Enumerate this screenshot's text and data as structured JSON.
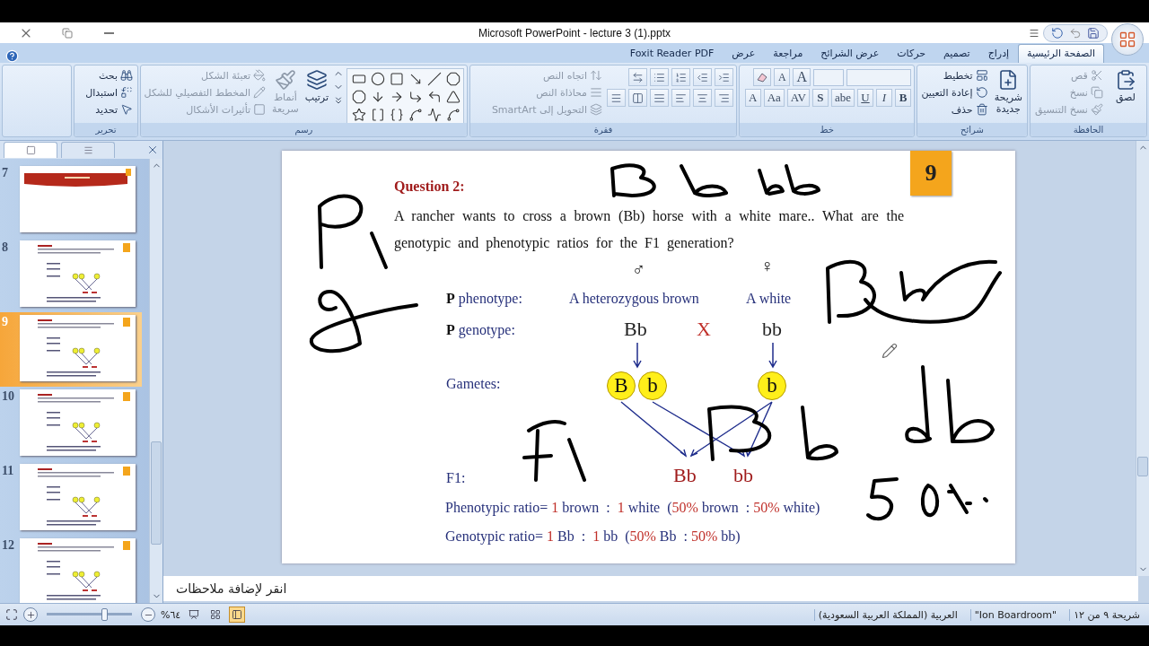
{
  "window": {
    "title": "Microsoft PowerPoint - lecture 3 (1).pptx"
  },
  "ribbon": {
    "tabs": [
      {
        "label": "الصفحة الرئيسية",
        "selected": true
      },
      {
        "label": "إدراج",
        "selected": false
      },
      {
        "label": "تصميم",
        "selected": false
      },
      {
        "label": "حركات",
        "selected": false
      },
      {
        "label": "عرض الشرائح",
        "selected": false
      },
      {
        "label": "مراجعة",
        "selected": false
      },
      {
        "label": "عرض",
        "selected": false
      },
      {
        "label": "Foxit Reader PDF",
        "selected": false
      }
    ],
    "groups": [
      {
        "kind": "commands",
        "title": "الحافظة",
        "items": [
          {
            "kind": "large",
            "label": "لصق",
            "disabled": false
          },
          {
            "kind": "small",
            "label": "قص",
            "disabled": true
          },
          {
            "kind": "small",
            "label": "نسخ",
            "disabled": true
          },
          {
            "kind": "small",
            "label": "نسخ التنسيق",
            "disabled": true
          }
        ]
      },
      {
        "kind": "commands",
        "title": "شرائح",
        "items": [
          {
            "kind": "large",
            "label": "شريحة جديدة",
            "disabled": false
          },
          {
            "kind": "small",
            "label": "تخطيط",
            "disabled": false
          },
          {
            "kind": "small",
            "label": "إعادة التعيين",
            "disabled": false
          },
          {
            "kind": "small",
            "label": "حذف",
            "disabled": false
          }
        ]
      },
      {
        "kind": "font",
        "title": "خط",
        "size_buttons": [
          "A",
          "A"
        ],
        "buttons": [
          "B",
          "I",
          "U",
          "abe",
          "S",
          "AV",
          "Aa",
          "A"
        ]
      },
      {
        "kind": "paragraph",
        "title": "فقرة",
        "items": [
          {
            "kind": "small",
            "label": "اتجاه النص",
            "disabled": true
          },
          {
            "kind": "small",
            "label": "محاذاة النص",
            "disabled": true
          },
          {
            "kind": "small",
            "label": "التحويل إلى SmartArt",
            "disabled": true
          }
        ]
      },
      {
        "kind": "shapes",
        "title": "رسم",
        "items": [
          {
            "kind": "large",
            "label": "ترتيب",
            "disabled": false
          },
          {
            "kind": "large",
            "label": "أنماط سريعة",
            "disabled": true
          },
          {
            "kind": "small",
            "label": "تعبئة الشكل",
            "disabled": true
          },
          {
            "kind": "small",
            "label": "المخطط التفصيلي للشكل",
            "disabled": true
          },
          {
            "kind": "small",
            "label": "تأثيرات الأشكال",
            "disabled": true
          }
        ]
      },
      {
        "kind": "commands",
        "title": "تحرير",
        "items": [
          {
            "kind": "small",
            "label": "بحث",
            "disabled": false
          },
          {
            "kind": "small",
            "label": "استبدال",
            "disabled": false
          },
          {
            "kind": "small",
            "label": "تحديد",
            "disabled": false
          }
        ]
      }
    ]
  },
  "slides": [
    {
      "number": "7",
      "kind": "title",
      "selected": false
    },
    {
      "number": "8",
      "kind": "diagram",
      "selected": false
    },
    {
      "number": "9",
      "kind": "diagram",
      "selected": true
    },
    {
      "number": "10",
      "kind": "diagram",
      "selected": false
    },
    {
      "number": "11",
      "kind": "diagram",
      "selected": false
    },
    {
      "number": "12",
      "kind": "diagram",
      "selected": false
    }
  ],
  "slide": {
    "badge": "9",
    "heading": "Question 2:",
    "question": "A rancher wants to cross a brown (Bb) horse with a white mare.. What are the genotypic and phenotypic ratios for the F1 generation?",
    "male_symbol": "♂",
    "female_symbol": "♀",
    "phenotype_label": {
      "prefix": "P",
      "text": " phenotype:"
    },
    "male_phenotype": "A heterozygous brown",
    "female_phenotype": "A white",
    "genotype_label": {
      "prefix": "P",
      "text": " genotype:"
    },
    "male_genotype": "Bb",
    "cross": "X",
    "female_genotype": "bb",
    "gametes_label": "Gametes:",
    "male_gametes": {
      "dominant": "B",
      "recessive": "b"
    },
    "female_gamete": "b",
    "f1_label": "F1:",
    "offspring": {
      "heterozygous": "Bb",
      "homozygous": "bb"
    },
    "ratios": [
      {
        "label": "Phenotypic ratio=",
        "first_count": "1",
        "first_trait": "brown  :",
        "second_count": "1",
        "second_trait": "white  (",
        "first_share": "50%",
        "first_share_trait": "brown  :",
        "second_share": "50%",
        "second_share_trait": "white)"
      },
      {
        "label": "Genotypic ratio=",
        "first_count": "1",
        "first_trait": "Bb  :",
        "second_count": "1",
        "second_trait": "bb  (",
        "first_share": "50%",
        "first_share_trait": "Bb  :",
        "second_share": "50%",
        "second_share_trait": "bb)"
      }
    ]
  },
  "notes": {
    "placeholder": "انقر لإضافة ملاحظات"
  },
  "status_bar": {
    "slide_position": "شريحة ٩ من ١٢",
    "theme": "\"Ion Boardroom\"",
    "language": "العربية (المملكة العربية السعودية)",
    "zoom": {
      "label": "%٦٤",
      "level": 0.67
    },
    "views": [
      {
        "kind": "slideshow",
        "selected": false
      },
      {
        "kind": "sorter",
        "selected": false
      },
      {
        "kind": "normal",
        "selected": true
      }
    ]
  }
}
